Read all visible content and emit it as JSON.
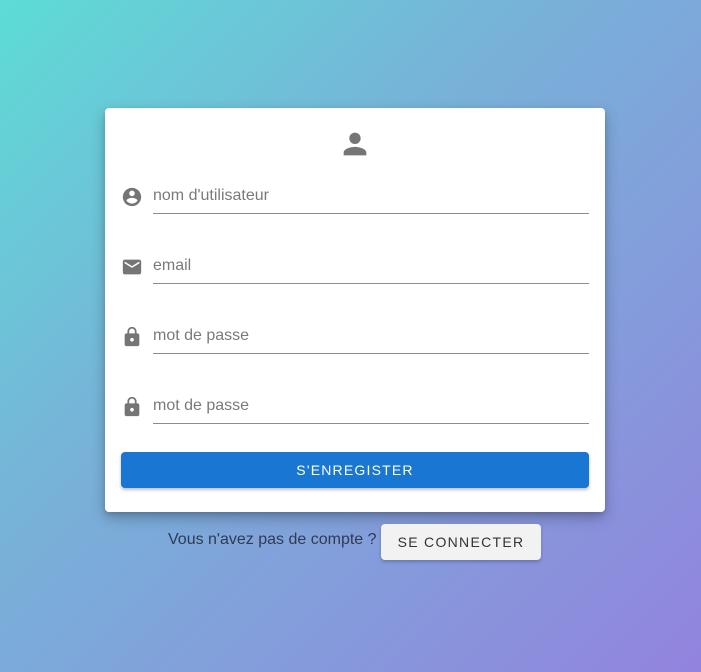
{
  "colors": {
    "gradient_start": "#5ddcd6",
    "gradient_end": "#9283de",
    "primary": "#1976d2",
    "icon": "#757575",
    "card": "#ffffff"
  },
  "register_form": {
    "header_icon": "person-icon",
    "fields": [
      {
        "icon": "account-circle-icon",
        "placeholder": "nom d'utilisateur",
        "value": ""
      },
      {
        "icon": "mail-icon",
        "placeholder": "email",
        "value": ""
      },
      {
        "icon": "lock-icon",
        "placeholder": "mot de passe",
        "value": ""
      },
      {
        "icon": "lock-icon",
        "placeholder": "mot de passe",
        "value": ""
      }
    ],
    "submit_label": "S'ENREGISTER"
  },
  "footer": {
    "prompt_text": "Vous n'avez pas de compte ?",
    "login_label": "SE CONNECTER"
  }
}
